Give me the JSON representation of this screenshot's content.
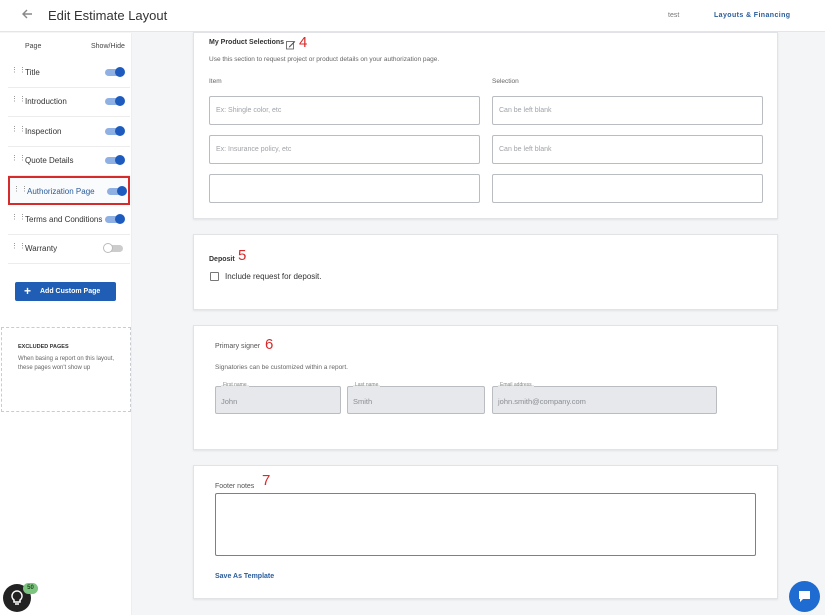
{
  "header": {
    "title": "Edit Estimate Layout",
    "user": "test",
    "nav_link": "Layouts & Financing"
  },
  "sidebar": {
    "col_page": "Page",
    "col_show": "Show/Hide",
    "items": [
      {
        "label": "Title",
        "on": true
      },
      {
        "label": "Introduction",
        "on": true
      },
      {
        "label": "Inspection",
        "on": true
      },
      {
        "label": "Quote Details",
        "on": true
      },
      {
        "label": "Authorization Page",
        "on": true,
        "active": true
      },
      {
        "label": "Terms and Conditions",
        "on": true
      },
      {
        "label": "Warranty",
        "on": false
      }
    ],
    "add_button": "Add Custom Page",
    "excluded": {
      "title": "EXCLUDED PAGES",
      "text": "When basing a report on this layout, these pages won't show up"
    }
  },
  "product_section": {
    "title": "My Product Selections",
    "marker": "4",
    "description": "Use this section to request project or product details on your authorization page.",
    "col_item": "Item",
    "col_selection": "Selection",
    "rows": [
      {
        "item_placeholder": "Ex: Shingle color, etc",
        "selection_placeholder": "Can be left blank"
      },
      {
        "item_placeholder": "Ex: Insurance policy, etc",
        "selection_placeholder": "Can be left blank"
      },
      {
        "item_placeholder": "",
        "selection_placeholder": ""
      }
    ]
  },
  "deposit_section": {
    "title": "Deposit",
    "marker": "5",
    "checkbox_label": "Include request for deposit."
  },
  "signer_section": {
    "title": "Primary signer",
    "marker": "6",
    "description": "Signatories can be customized within a report.",
    "first_name_label": "First name",
    "first_name": "John",
    "last_name_label": "Last name",
    "last_name": "Smith",
    "email_label": "Email address",
    "email": "john.smith@company.com"
  },
  "footer_section": {
    "title": "Footer notes",
    "marker": "7",
    "save_template": "Save As Template"
  },
  "help_badge": "50",
  "colors": {
    "accent": "#1f5eb4",
    "marker_red": "#d62b2b",
    "toggle_on": "#1d5bbf"
  },
  "icons": [
    "back-arrow-icon",
    "drag-handle-icon",
    "edit-icon",
    "plus-icon",
    "lightbulb-icon",
    "chat-icon"
  ]
}
